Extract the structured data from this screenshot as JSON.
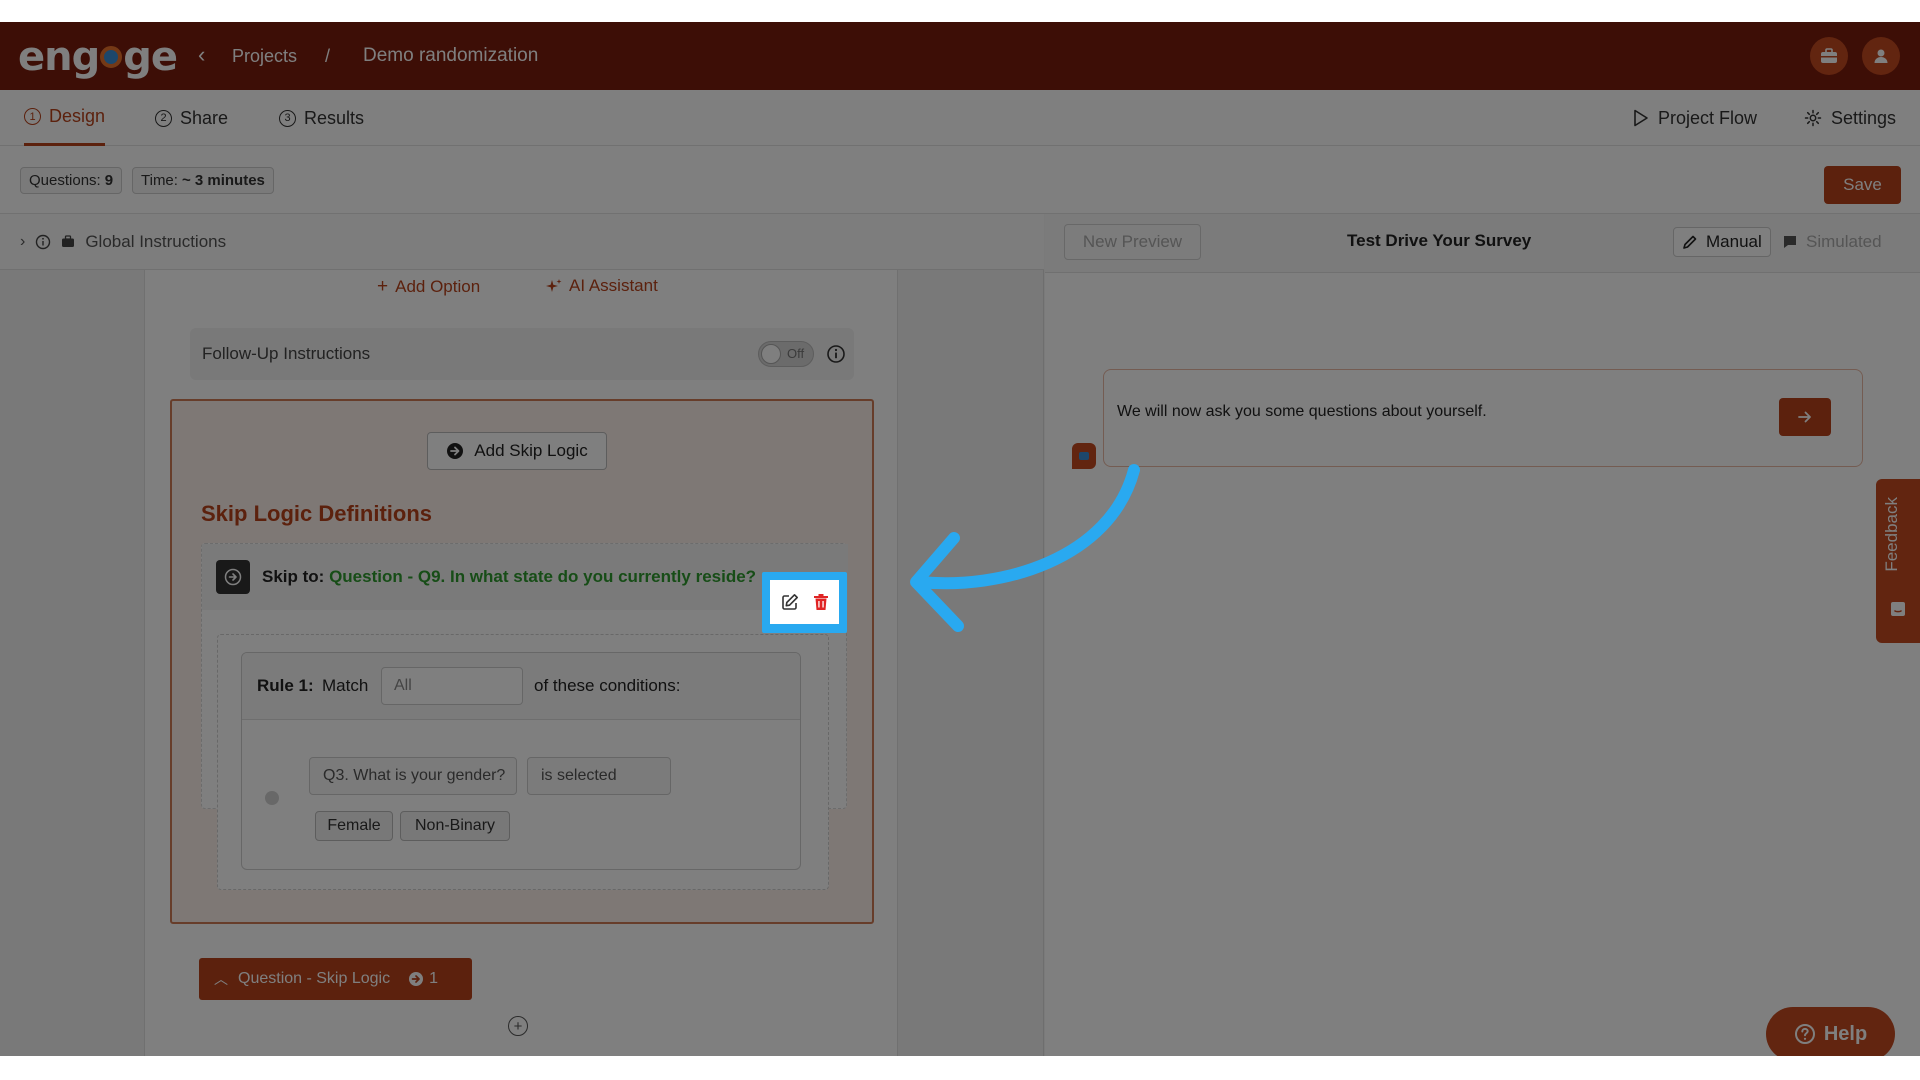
{
  "app": {
    "logo": "engage",
    "back_icon": "chevron-left-icon"
  },
  "breadcrumb": {
    "projects": "Projects",
    "separator": "/",
    "current": "Demo randomization"
  },
  "tabs": [
    {
      "num": "1",
      "label": "Design",
      "active": true
    },
    {
      "num": "2",
      "label": "Share",
      "active": false
    },
    {
      "num": "3",
      "label": "Results",
      "active": false
    }
  ],
  "right_tabs": {
    "project_flow": "Project Flow",
    "settings": "Settings"
  },
  "info": {
    "questions_label": "Questions:",
    "questions_value": "9",
    "time_label": "Time:",
    "time_value": "~ 3 minutes",
    "save": "Save"
  },
  "global_instructions": "Global Instructions",
  "editor": {
    "add_option": "Add Option",
    "ai_assistant": "AI Assistant",
    "followup_label": "Follow-Up Instructions",
    "followup_toggle": "Off",
    "add_skip_logic": "Add Skip Logic",
    "skip_logic_title": "Skip Logic Definitions",
    "skip_to_label": "Skip to:",
    "skip_to_target": "Question - Q9. In what state do you currently reside?",
    "rule_label": "Rule 1:",
    "match_label": "Match",
    "match_value": "All",
    "conditions_label": "of these conditions:",
    "condition_question": "Q3. What is your gender?",
    "condition_operator": "is selected",
    "condition_values": [
      "Female",
      "Non-Binary"
    ],
    "question_skip_logic_btn": "Question - Skip Logic",
    "skip_count": "1"
  },
  "preview": {
    "new_preview": "New Preview",
    "title": "Test Drive Your Survey",
    "manual": "Manual",
    "simulated": "Simulated",
    "message": "We will now ask you some questions about yourself."
  },
  "feedback": "Feedback",
  "help": "Help",
  "colors": {
    "brand_dark": "#7a1c0c",
    "brand": "#b8421b",
    "accent_green": "#2e9a2e",
    "highlight": "#29a9f0"
  }
}
